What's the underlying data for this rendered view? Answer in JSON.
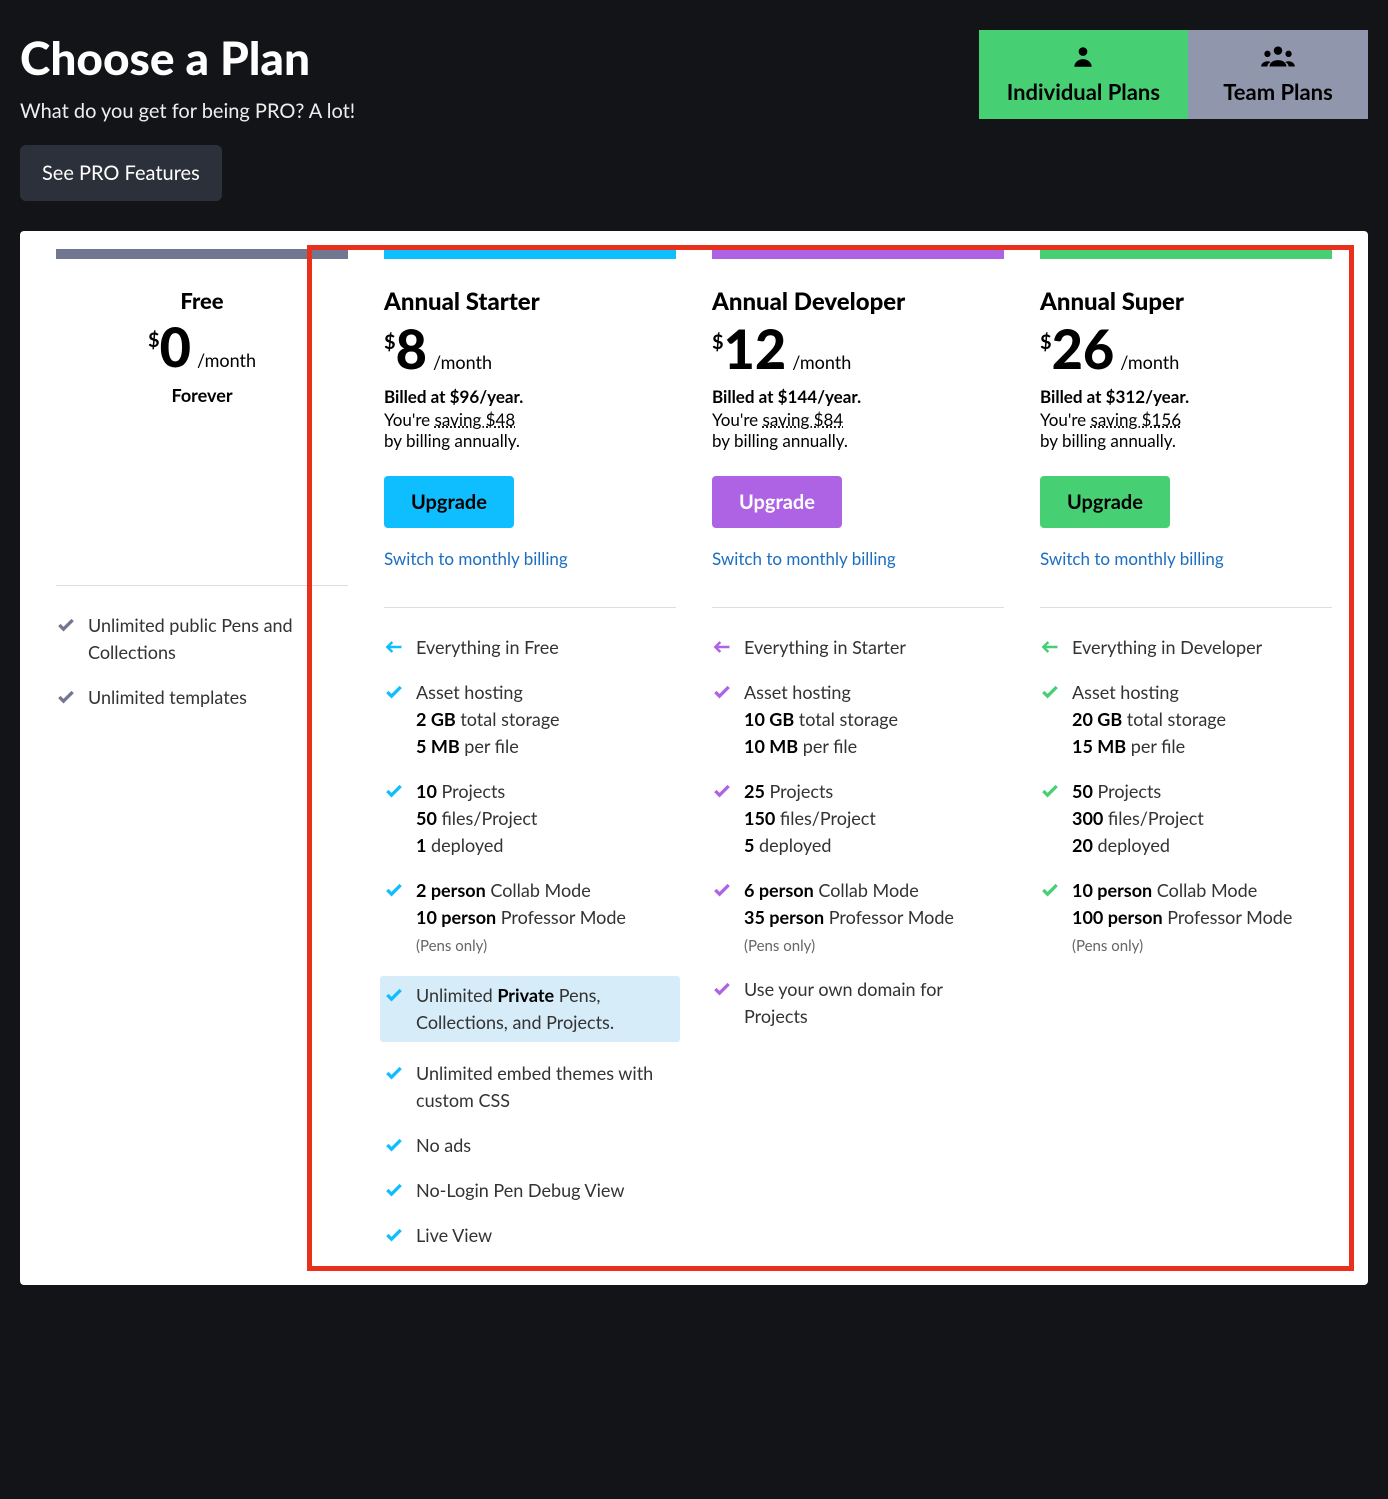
{
  "header": {
    "title": "Choose a Plan",
    "subtitle": "What do you get for being PRO? A lot!",
    "see_pro_label": "See PRO Features"
  },
  "tabs": {
    "individual": "Individual Plans",
    "team": "Team Plans"
  },
  "labels": {
    "per_month": "/month",
    "upgrade": "Upgrade",
    "switch": "Switch to monthly billing",
    "pens_only": "(Pens only)"
  },
  "plans": {
    "free": {
      "name": "Free",
      "price": "0",
      "forever": "Forever",
      "features": [
        "Unlimited public Pens and Collections",
        "Unlimited templates"
      ]
    },
    "starter": {
      "name": "Annual Starter",
      "price": "8",
      "billed": "Billed at $96/year.",
      "saving_prefix": "You're ",
      "saving": "saving $48",
      "saving_suffix": "by billing annually.",
      "feat_everything": "Everything in Free",
      "feat_asset": "Asset hosting",
      "feat_asset_storage": "2 GB",
      "feat_asset_storage_label": " total storage",
      "feat_asset_file": "5 MB",
      "feat_asset_file_label": " per file",
      "feat_projects_n": "10",
      "feat_projects_label": " Projects",
      "feat_files_n": "50",
      "feat_files_label": " files/Project",
      "feat_deployed_n": "1",
      "feat_deployed_label": " deployed",
      "feat_collab_n": "2 person",
      "feat_collab_label": " Collab Mode",
      "feat_prof_n": "10 person",
      "feat_prof_label": " Professor Mode",
      "feat_private_pre": "Unlimited ",
      "feat_private_bold": "Private",
      "feat_private_post": " Pens, Collections, and Projects.",
      "feat_embed": "Unlimited embed themes with custom CSS",
      "feat_noads": "No ads",
      "feat_nologin": "No-Login Pen Debug View",
      "feat_live": "Live View"
    },
    "developer": {
      "name": "Annual Developer",
      "price": "12",
      "billed": "Billed at $144/year.",
      "saving_prefix": "You're ",
      "saving": "saving $84",
      "saving_suffix": "by billing annually.",
      "feat_everything": "Everything in Starter",
      "feat_asset": "Asset hosting",
      "feat_asset_storage": "10 GB",
      "feat_asset_storage_label": " total storage",
      "feat_asset_file": "10 MB",
      "feat_asset_file_label": " per file",
      "feat_projects_n": "25",
      "feat_projects_label": " Projects",
      "feat_files_n": "150",
      "feat_files_label": " files/Project",
      "feat_deployed_n": "5",
      "feat_deployed_label": " deployed",
      "feat_collab_n": "6 person",
      "feat_collab_label": " Collab Mode",
      "feat_prof_n": "35 person",
      "feat_prof_label": " Professor Mode",
      "feat_domain": "Use your own domain for Projects"
    },
    "super": {
      "name": "Annual Super",
      "price": "26",
      "billed": "Billed at $312/year.",
      "saving_prefix": "You're ",
      "saving": "saving $156",
      "saving_suffix": "by billing annually.",
      "feat_everything": "Everything in Developer",
      "feat_asset": "Asset hosting",
      "feat_asset_storage": "20 GB",
      "feat_asset_storage_label": " total storage",
      "feat_asset_file": "15 MB",
      "feat_asset_file_label": " per file",
      "feat_projects_n": "50",
      "feat_projects_label": " Projects",
      "feat_files_n": "300",
      "feat_files_label": " files/Project",
      "feat_deployed_n": "20",
      "feat_deployed_label": " deployed",
      "feat_collab_n": "10 person",
      "feat_collab_label": " Collab Mode",
      "feat_prof_n": "100 person",
      "feat_prof_label": " Professor Mode"
    }
  }
}
